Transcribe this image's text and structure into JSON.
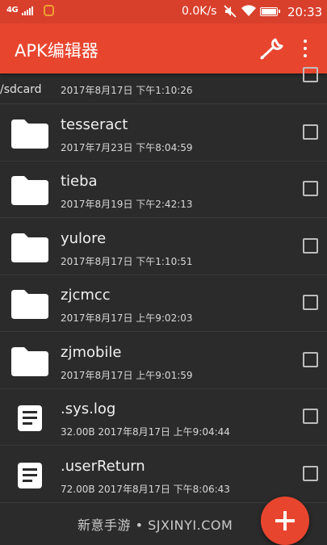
{
  "status_bar": {
    "network": "4G",
    "speed": "0.0K/s",
    "time": "20:33"
  },
  "toolbar": {
    "title": "APK编辑器",
    "tools_icon": "wrench-icon",
    "menu_icon": "more-vert-icon"
  },
  "path": "/sdcard",
  "items": [
    {
      "name": "",
      "meta": "2017年8月17日 下午1:10:26",
      "type": "folder"
    },
    {
      "name": "tesseract",
      "meta": "2017年7月23日 下午8:04:59",
      "type": "folder"
    },
    {
      "name": "tieba",
      "meta": "2017年8月19日 下午2:42:13",
      "type": "folder"
    },
    {
      "name": "yulore",
      "meta": "2017年8月17日 下午1:10:51",
      "type": "folder"
    },
    {
      "name": "zjcmcc",
      "meta": "2017年8月17日 上午9:02:03",
      "type": "folder"
    },
    {
      "name": "zjmobile",
      "meta": "2017年8月17日 上午9:01:59",
      "type": "folder"
    },
    {
      "name": ".sys.log",
      "meta": "32.00B   2017年8月17日 上午9:04:44",
      "type": "file"
    },
    {
      "name": ".userReturn",
      "meta": "72.00B   2017年8月17日 下午8:06:43",
      "type": "file"
    }
  ],
  "watermark": "新意手游 • SJXINYI.COM",
  "fab_icon": "add-icon",
  "colors": {
    "accent": "#e8452f",
    "status_bar": "#d8402c",
    "background": "#2b2b2b"
  }
}
